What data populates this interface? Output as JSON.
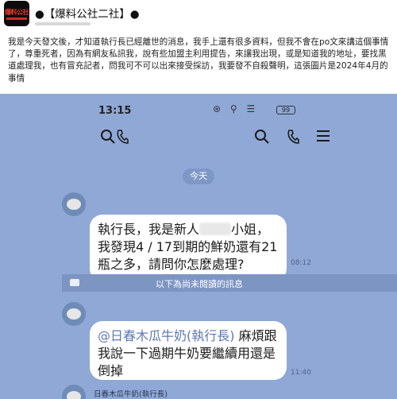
{
  "page": {
    "name": "●【爆料公社二社】●",
    "avatar_logo_text": "爆料公社"
  },
  "post": {
    "text": "我是今天發文後，才知道執行長已經離世的消息，我手上還有很多資料，但我不會在po文來講這個事情了，尊重死者，因為有網友私訊我，說有些加盟主利用提告，來讓我出現，或是知道我的地址，要找黑道處理我，也有冒充記者，問我可不可以出來接受採訪，我要發不自殺聲明，這張圖片是2024年4月的事情"
  },
  "screenshot": {
    "status": {
      "time": "13:15",
      "battery": "99"
    },
    "date_label": "今天",
    "messages": [
      {
        "text_before": "執行長，我是新人",
        "text_after": "小姐，我發現4 / 17到期的鮮奶還有21瓶之多，請問你怎麼處理?",
        "time": "08:12"
      },
      {
        "mention": "@日春木瓜牛奶(執行長)",
        "text": " 麻煩跟我說一下過期牛奶要繼續用還是倒掉",
        "time": "11:40"
      }
    ],
    "unread_label": "以下為尚未閱讀的訊息",
    "next_sender": "日春木瓜牛奶(執行長)"
  },
  "icons": [
    "search-icon",
    "phone-icon",
    "menu-icon",
    "wifi-icon",
    "signal-icon",
    "battery-icon"
  ],
  "colors": {
    "chat_background": "#8fa8d6",
    "bubble": "#ffffff",
    "mention": "#5e77b3"
  }
}
